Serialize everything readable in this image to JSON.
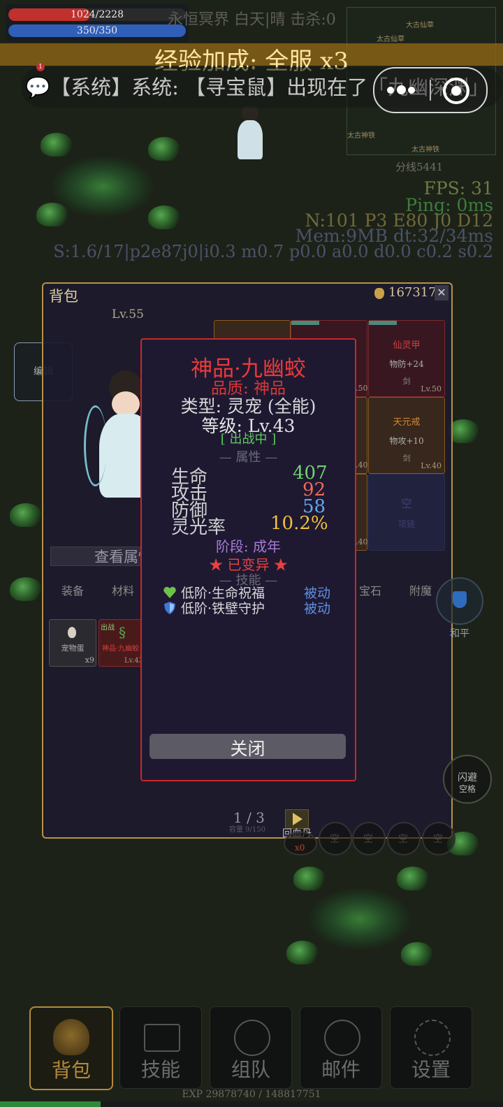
{
  "hud": {
    "hp_text": "1024/2228",
    "hp_fraction": 0.46,
    "mp_text": "350/350",
    "mp_fraction": 1.0,
    "map_info": "永恒冥界  白天|晴  击杀:0",
    "exp_bonus": "经验加成: 全服 x3",
    "system_message": "💬【系统】系统: 【寻宝鼠】出现在了「九幽深渊」",
    "notify_count": "1"
  },
  "minimap": {
    "labels": [
      "太古仙草",
      "大古仙草",
      "太古神铁",
      "太古神铁"
    ],
    "line": "分线5441"
  },
  "debug": {
    "fps": "FPS: 31",
    "ping": "Ping: 0ms",
    "net": "N:101 P3 E80 J0 D12",
    "mem": "Mem:9MB dt:32/34ms",
    "stats": "S:1.6/17|p2e87j0|i0.3 m0.7 p0.0 a0.0 d0.0 c0.2 s0.2"
  },
  "left_button": "编辑",
  "bag": {
    "title": "背包",
    "gold": "1673177",
    "char_level": "Lv.55",
    "view_attrs": "查看属性",
    "tabs": [
      "装备",
      "材料",
      "宝石",
      "附魔"
    ],
    "page": "1 / 3",
    "capacity": "容量 9/150",
    "equip_slots": [
      {
        "name": "仙灵甲",
        "stat": "物防+24",
        "extra": "剑",
        "level": "Lv.50"
      },
      {
        "name": "天元戒",
        "stat": "物攻+10",
        "extra": "剑",
        "level": "Lv.40"
      },
      {
        "name": "空",
        "stat": "项链",
        "extra": "",
        "level": ""
      }
    ],
    "mid_levels": [
      ".50",
      ".40",
      ".40"
    ],
    "items": [
      {
        "name": "宠物蛋",
        "count": "x9"
      },
      {
        "name": "神品·九幽蛟",
        "tag": "出战",
        "level": "Lv.43"
      }
    ]
  },
  "popup": {
    "title": "神品·九幽蛟",
    "quality": "品质: 神品",
    "type": "类型: 灵宠 (全能)",
    "level": "等级: Lv.43",
    "status": "[ 出战中 ]",
    "attr_header": "— 属性 —",
    "attrs": [
      {
        "label": "生命",
        "value": "407",
        "color": "#6fd36f"
      },
      {
        "label": "攻击",
        "value": "92",
        "color": "#ef6b5b"
      },
      {
        "label": "防御",
        "value": "58",
        "color": "#5ea8f0"
      },
      {
        "label": "灵光率",
        "value": "10.2%",
        "color": "#f0c040"
      }
    ],
    "stage": "阶段: 成年",
    "mutated": "★ 已变异 ★",
    "skill_header": "— 技能 —",
    "skills": [
      {
        "name": "低阶·生命祝福",
        "kind": "被动",
        "icon": "heart-icon"
      },
      {
        "name": "低阶·铁壁守护",
        "kind": "被动",
        "icon": "shield-icon"
      }
    ],
    "close": "关闭"
  },
  "side": {
    "peace": "和平",
    "dodge": "闪避",
    "dodge_key": "空格",
    "potion": "回血丹",
    "potion_count": "x0",
    "quick_slots": [
      "空",
      "空",
      "空",
      "空"
    ]
  },
  "nav": [
    {
      "label": "背包",
      "icon": "bag-icon"
    },
    {
      "label": "技能",
      "icon": "book-icon"
    },
    {
      "label": "组队",
      "icon": "team-icon"
    },
    {
      "label": "邮件",
      "icon": "mail-icon"
    },
    {
      "label": "设置",
      "icon": "gear-icon"
    }
  ],
  "exp_text": "EXP 29878740 / 148817751",
  "exp_fraction": 0.2
}
